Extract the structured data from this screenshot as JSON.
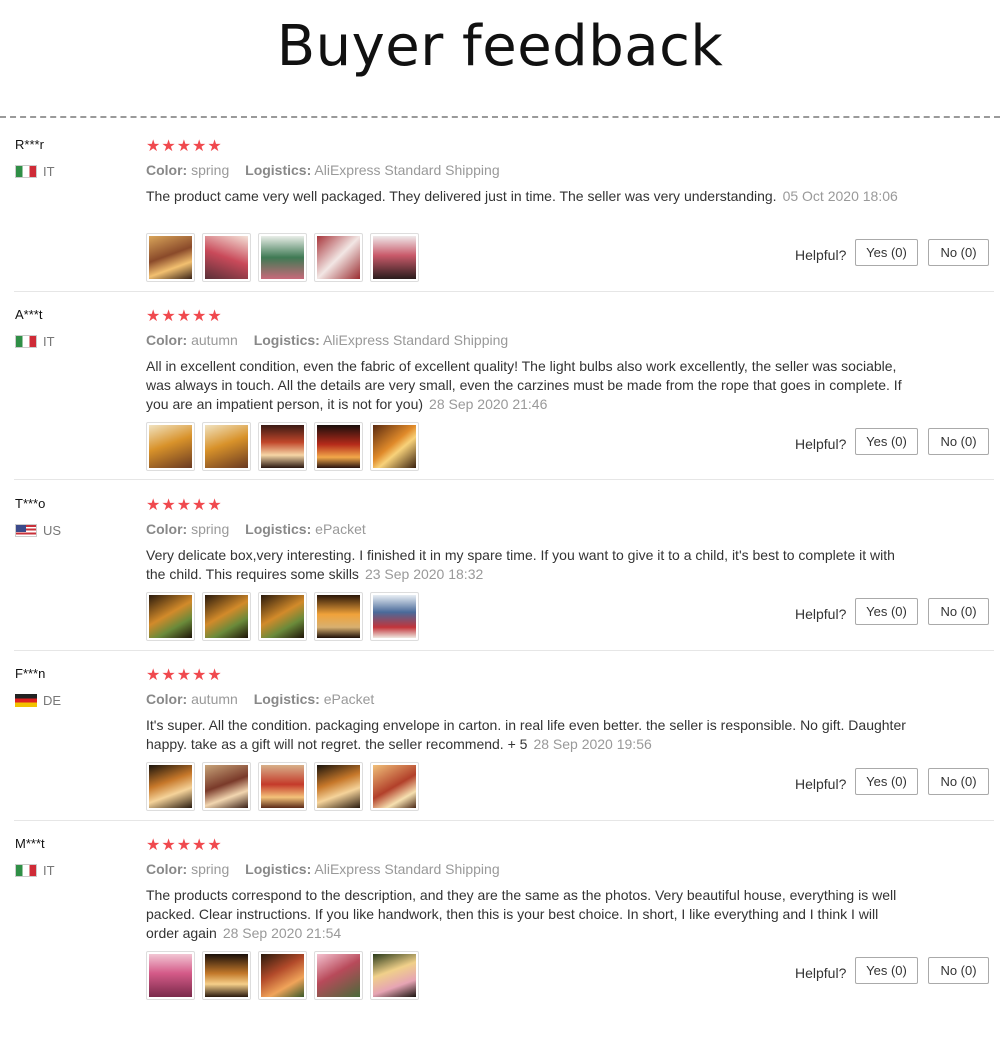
{
  "page": {
    "title": "Buyer feedback"
  },
  "helpful_label": "Helpful?",
  "props_labels": {
    "color": "Color:",
    "logistics": "Logistics:"
  },
  "colors": {
    "star": "#f0494e",
    "accent_text": "#999999"
  },
  "reviews": [
    {
      "user": "R***r",
      "country": "IT",
      "flag": "italy-flag",
      "rating": 5,
      "stars": "★★★★★",
      "color": "spring",
      "logistics": "AliExpress Standard Shipping",
      "text": "The product came very well packaged. They delivered just in time. The seller was very understanding.",
      "date": "05 Oct 2020 18:06",
      "photos": 5,
      "yes": "Yes (0)",
      "no": "No (0)"
    },
    {
      "user": "A***t",
      "country": "IT",
      "flag": "italy-flag",
      "rating": 5,
      "stars": "★★★★★",
      "color": "autumn",
      "logistics": "AliExpress Standard Shipping",
      "text": "All in excellent condition, even the fabric of excellent quality! The light bulbs also work excellently, the seller was sociable, was always in touch. All the details are very small, even the carzines must be made from the rope that goes in complete. If you are an impatient person, it is not for you)",
      "date": "28 Sep 2020 21:46",
      "photos": 5,
      "yes": "Yes (0)",
      "no": "No (0)"
    },
    {
      "user": "T***o",
      "country": "US",
      "flag": "usa-flag",
      "rating": 5,
      "stars": "★★★★★",
      "color": "spring",
      "logistics": "ePacket",
      "text": "Very delicate box,very interesting. I finished it in my spare time. If you want to give it to a child, it's best to complete it with the child. This requires some skills",
      "date": "23 Sep 2020 18:32",
      "photos": 5,
      "yes": "Yes (0)",
      "no": "No (0)"
    },
    {
      "user": "F***n",
      "country": "DE",
      "flag": "germany-flag",
      "rating": 5,
      "stars": "★★★★★",
      "color": "autumn",
      "logistics": "ePacket",
      "text": "It's super. All the condition. packaging envelope in carton. in real life even better. the seller is responsible. No gift. Daughter happy. take as a gift will not regret. the seller recommend. + 5",
      "date": "28 Sep 2020 19:56",
      "photos": 5,
      "yes": "Yes (0)",
      "no": "No (0)"
    },
    {
      "user": "M***t",
      "country": "IT",
      "flag": "italy-flag",
      "rating": 5,
      "stars": "★★★★★",
      "color": "spring",
      "logistics": "AliExpress Standard Shipping",
      "text": "The products correspond to the description, and they are the same as the photos. Very beautiful house, everything is well packed. Clear instructions. If you like handwork, then this is your best choice. In short, I like everything and I think I will order again",
      "date": "28 Sep 2020 21:54",
      "photos": 5,
      "yes": "Yes (0)",
      "no": "No (0)"
    }
  ]
}
